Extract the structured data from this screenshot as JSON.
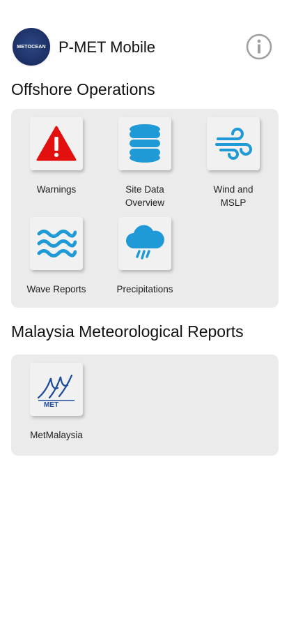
{
  "header": {
    "logo_text": "METOCEAN",
    "app_title": "P-MET Mobile",
    "info_icon": "info-circle-icon"
  },
  "sections": [
    {
      "title": "Offshore Operations",
      "tiles": [
        {
          "label": "Warnings",
          "icon": "warning-triangle-icon",
          "color": "#e31010"
        },
        {
          "label": "Site Data\nOverview",
          "icon": "database-icon",
          "color": "#1f9ad6"
        },
        {
          "label": "Wind and\nMSLP",
          "icon": "wind-icon",
          "color": "#1f9ad6"
        },
        {
          "label": "Wave Reports",
          "icon": "waves-icon",
          "color": "#1f9ad6"
        },
        {
          "label": "Precipitations",
          "icon": "rain-cloud-icon",
          "color": "#1f9ad6"
        }
      ]
    },
    {
      "title": "Malaysia Meteorological Reports",
      "tiles": [
        {
          "label": "MetMalaysia",
          "icon": "metmalaysia-logo-icon",
          "logo_text": "MET",
          "color": "#1d4a9a"
        }
      ]
    }
  ]
}
